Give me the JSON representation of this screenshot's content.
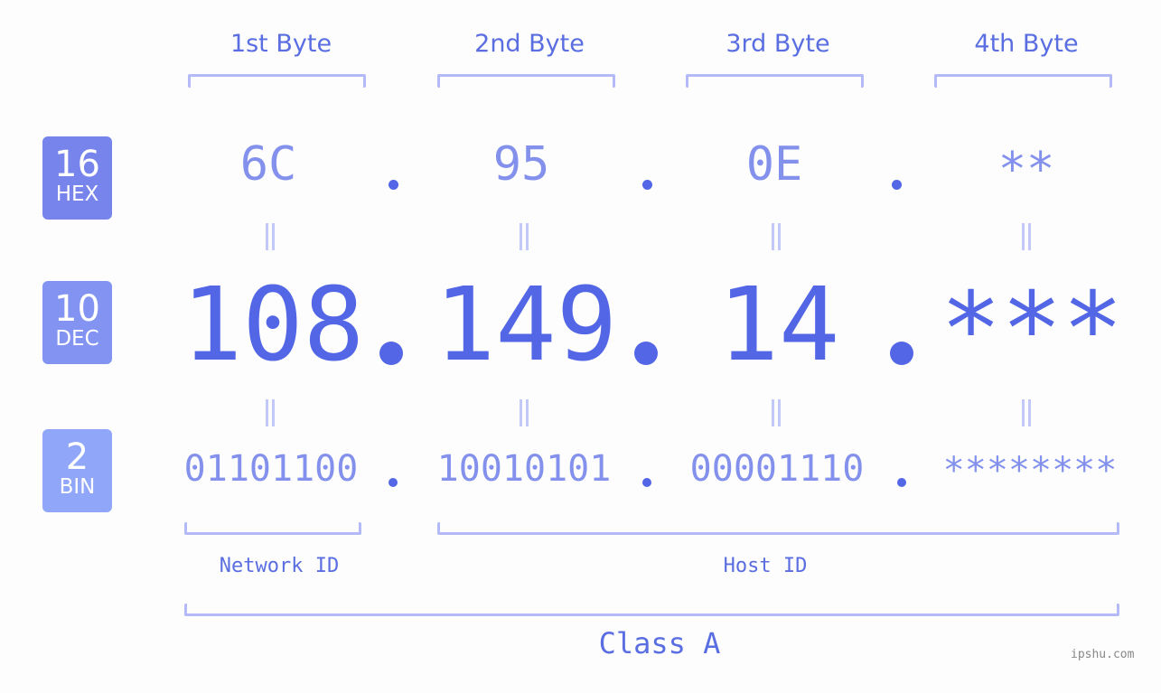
{
  "byte_headers": [
    "1st Byte",
    "2nd Byte",
    "3rd Byte",
    "4th Byte"
  ],
  "badges": {
    "hex": {
      "base": "16",
      "label": "HEX",
      "color": "#7784ec"
    },
    "dec": {
      "base": "10",
      "label": "DEC",
      "color": "#8393f2"
    },
    "bin": {
      "base": "2",
      "label": "BIN",
      "color": "#90a6f8"
    }
  },
  "hex_values": [
    "6C",
    "95",
    "0E",
    "**"
  ],
  "dec_values": [
    "108",
    "149",
    "14",
    "***"
  ],
  "bin_values": [
    "01101100",
    "10010101",
    "00001110",
    "********"
  ],
  "separator": ".",
  "equals_symbol": "=",
  "network_id_label": "Network ID",
  "host_id_label": "Host ID",
  "class_label": "Class A",
  "watermark": "ipshu.com",
  "colors": {
    "primary": "#5266e6",
    "secondary": "#8391ec",
    "bracket": "#b3baf7",
    "equals": "#c2c9f8"
  }
}
